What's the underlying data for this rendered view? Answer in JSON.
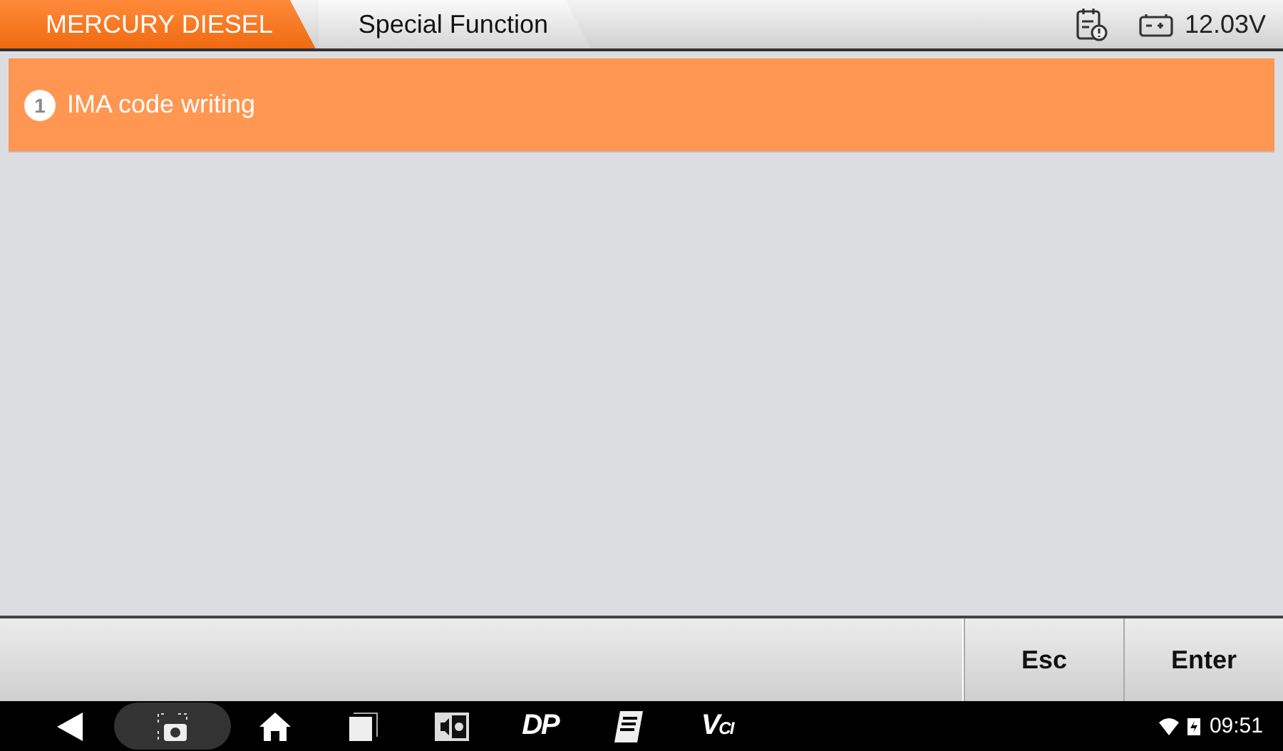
{
  "breadcrumb": [
    {
      "label": "MERCURY DIESEL",
      "selected": true
    },
    {
      "label": "Special Function",
      "selected": false
    }
  ],
  "status": {
    "voltage": "12.03V"
  },
  "items": [
    {
      "number": "1",
      "label": "IMA code writing",
      "selected": true
    }
  ],
  "buttons": [
    "Esc",
    "Enter"
  ],
  "nav": [
    {
      "kind": "back"
    },
    {
      "kind": "screenshot",
      "selected": true
    },
    {
      "kind": "home"
    },
    {
      "kind": "recent"
    },
    {
      "kind": "display"
    },
    {
      "kind": "text",
      "label": "DP"
    },
    {
      "kind": "manual"
    },
    {
      "kind": "vci",
      "label": "V",
      "sub": "CI"
    }
  ],
  "system": {
    "time": "09:51"
  }
}
